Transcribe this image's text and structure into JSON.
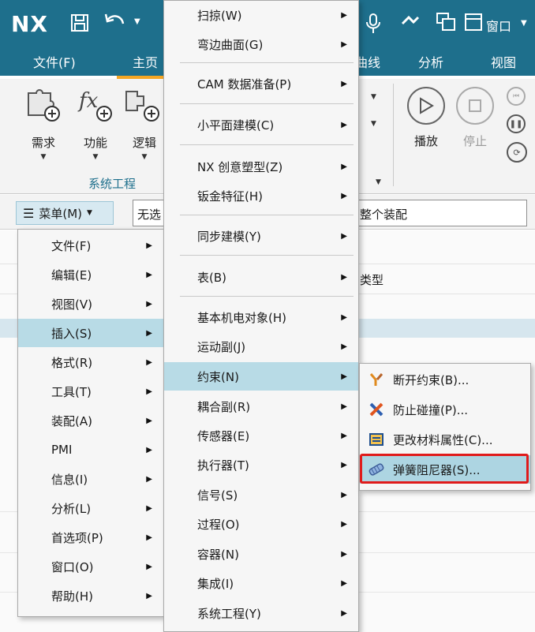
{
  "titlebar": {
    "logo": "NX",
    "window_label": "窗口"
  },
  "ribbon_tabs": {
    "file": "文件(F)",
    "home": "主页",
    "curve": "曲线",
    "analysis": "分析",
    "view": "视图"
  },
  "ribbon": {
    "requirements": "需求",
    "functions": "功能",
    "logic": "逻辑",
    "group_label": "系统工程",
    "play": "播放",
    "stop": "停止"
  },
  "toolbar": {
    "menu_label": "菜单(M)",
    "filter_value": "无选",
    "assembly_scope": "整个装配"
  },
  "background": {
    "column_type": "类型"
  },
  "main_menu": {
    "items": [
      {
        "label": "文件(F)"
      },
      {
        "label": "编辑(E)"
      },
      {
        "label": "视图(V)"
      },
      {
        "label": "插入(S)"
      },
      {
        "label": "格式(R)"
      },
      {
        "label": "工具(T)"
      },
      {
        "label": "装配(A)"
      },
      {
        "label": "PMI"
      },
      {
        "label": "信息(I)"
      },
      {
        "label": "分析(L)"
      },
      {
        "label": "首选项(P)"
      },
      {
        "label": "窗口(O)"
      },
      {
        "label": "帮助(H)"
      }
    ]
  },
  "insert_menu": {
    "items": [
      {
        "label": "扫掠(W)"
      },
      {
        "label": "弯边曲面(G)"
      },
      {
        "label": "CAM 数据准备(P)"
      },
      {
        "label": "小平面建模(C)"
      },
      {
        "label": "NX 创意塑型(Z)"
      },
      {
        "label": "钣金特征(H)"
      },
      {
        "label": "同步建模(Y)"
      },
      {
        "label": "表(B)"
      },
      {
        "label": "基本机电对象(H)"
      },
      {
        "label": "运动副(J)"
      },
      {
        "label": "约束(N)"
      },
      {
        "label": "耦合副(R)"
      },
      {
        "label": "传感器(E)"
      },
      {
        "label": "执行器(T)"
      },
      {
        "label": "信号(S)"
      },
      {
        "label": "过程(O)"
      },
      {
        "label": "容器(N)"
      },
      {
        "label": "集成(I)"
      },
      {
        "label": "系统工程(Y)"
      }
    ]
  },
  "constraint_menu": {
    "items": [
      {
        "label": "断开约束(B)...",
        "icon": "break-constraint-icon",
        "color": "#e08a1e"
      },
      {
        "label": "防止碰撞(P)...",
        "icon": "prevent-collision-icon",
        "color": "#2e5fb0"
      },
      {
        "label": "更改材料属性(C)...",
        "icon": "change-material-icon",
        "color": "#1f4f8f"
      },
      {
        "label": "弹簧阻尼器(S)...",
        "icon": "spring-damper-icon",
        "color": "#5a7fb8"
      }
    ]
  },
  "colors": {
    "title_bar": "#1e6f8c",
    "menu_highlight": "#b8dbe6",
    "annotation_box": "#e01b1b"
  }
}
